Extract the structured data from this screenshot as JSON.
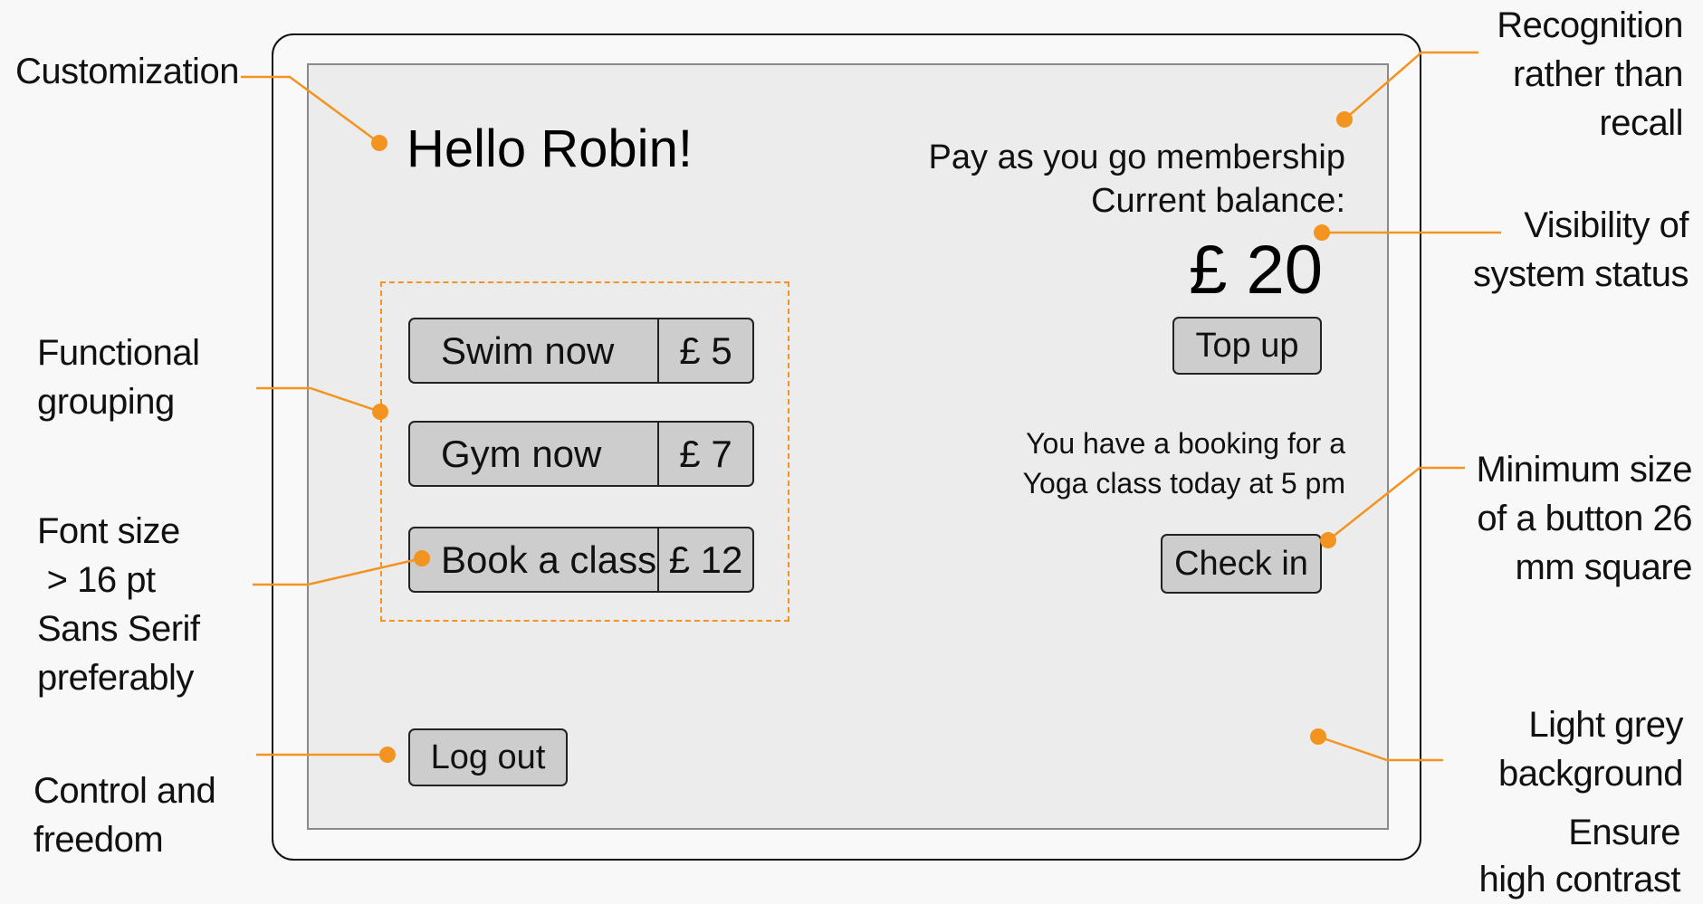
{
  "annotations": {
    "customization": "Customization",
    "recognition": [
      "Recognition",
      "rather than",
      "recall"
    ],
    "visibility": [
      "Visibility of",
      "system status"
    ],
    "functional_grouping": [
      "Functional",
      "grouping"
    ],
    "font_size": [
      "Font size",
      " > 16 pt",
      "Sans Serif",
      "preferably"
    ],
    "minimum_size": [
      "Minimum size",
      "of a button 26",
      "mm square"
    ],
    "control_freedom": [
      "Control and",
      "freedom"
    ],
    "light_grey": [
      "Light grey",
      "background"
    ],
    "contrast": [
      "Ensure",
      "high contrast"
    ]
  },
  "screen": {
    "greeting": "Hello Robin!",
    "membership": [
      "Pay as you go membership",
      "Current balance:"
    ],
    "balance": "£ 20",
    "top_up_label": "Top up",
    "booking": [
      "You have a booking for a",
      "Yoga class today at 5 pm"
    ],
    "check_in_label": "Check in",
    "logout_label": "Log out",
    "actions": [
      {
        "label": "Swim now",
        "price": "£ 5"
      },
      {
        "label": "Gym  now",
        "price": "£ 7"
      },
      {
        "label": "Book a class",
        "price": "£ 12"
      }
    ]
  },
  "colors": {
    "accent": "#f39320",
    "screen_background": "#ececec",
    "button_background": "#cdcdcd"
  }
}
